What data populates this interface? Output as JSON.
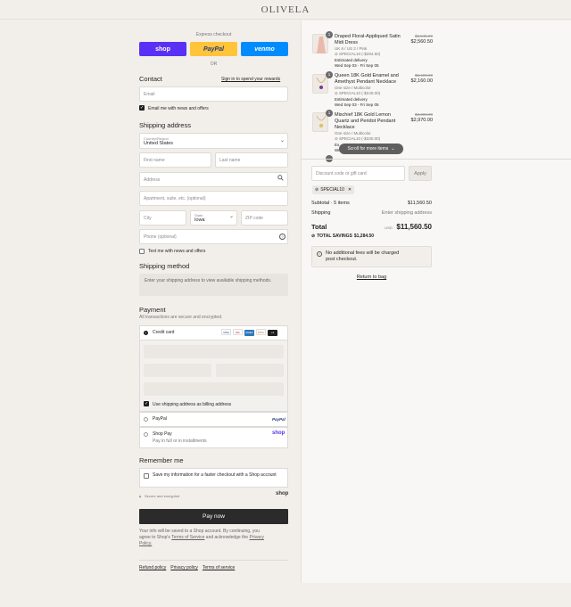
{
  "brand": {
    "logo": "OLIVELA"
  },
  "express": {
    "title": "Express checkout",
    "shop": "shop",
    "paypal": "PayPal",
    "venmo": "venmo",
    "or": "OR"
  },
  "contact": {
    "heading": "Contact",
    "signin_link": "Sign in to spend your rewards",
    "email_placeholder": "Email",
    "email_news": "Email me with news and offers"
  },
  "shipping_address": {
    "heading": "Shipping address",
    "country_label": "Country/Region",
    "country_value": "United States",
    "first_name": "First name",
    "last_name": "Last name",
    "address": "Address",
    "apartment": "Apartment, suite, etc. (optional)",
    "city": "City",
    "state_label": "State",
    "state_value": "Iowa",
    "zip": "ZIP code",
    "phone": "Phone (optional)",
    "text_news": "Text me with news and offers"
  },
  "shipping_method": {
    "heading": "Shipping method",
    "note": "Enter your shipping address to view available shipping methods."
  },
  "payment": {
    "heading": "Payment",
    "subtitle": "All transactions are secure and encrypted.",
    "credit_card": "Credit card",
    "cards": [
      "VISA",
      "MC",
      "AMEX",
      "DISC",
      "+4"
    ],
    "use_shipping_as_billing": "Use shipping address as billing address",
    "paypal": "PayPal",
    "paypal_logo": "PayPal",
    "shop_pay": "Shop Pay",
    "shop_pay_sub": "Pay in full or in installments",
    "shop_pay_logo": "shop"
  },
  "remember": {
    "heading": "Remember me",
    "save_info": "Save my information for a faster checkout with a Shop account",
    "secure": "Secure and encrypted",
    "shop_logo": "shop"
  },
  "pay_now": "Pay now",
  "legal": {
    "line1": "Your info will be saved to a Shop account. By continuing, you",
    "line2a": "agree to Shop's ",
    "tos": "Terms of Service",
    "line2b": " and acknowledge the ",
    "privacy": "Privacy",
    "line3": "Policy."
  },
  "footer_links": [
    "Refund policy",
    "Privacy policy",
    "Terms of service"
  ],
  "items": [
    {
      "qty": "1",
      "name_lines": [
        "Draped Floral-Appliqued Satin",
        "Midi Dress"
      ],
      "variant": "UK 6 / US 2 / Pink",
      "discount": "SPECIAL10 (-$284.50)",
      "delivery_label": "Estimated delivery",
      "delivery": "Wed Sep 03 - Fri Sep 05",
      "orig_price": "$2,845.00",
      "price": "$2,560.50"
    },
    {
      "qty": "1",
      "name_lines": [
        "Queen 18K Gold Enamel and",
        "Amethyst Pendant Necklace"
      ],
      "variant": "One size / Multicolor",
      "discount": "SPECIAL10 (-$240.00)",
      "delivery_label": "Estimated delivery",
      "delivery": "Wed Sep 03 - Fri Sep 05",
      "orig_price": "$2,400.00",
      "price": "$2,160.00"
    },
    {
      "qty": "1",
      "name_lines": [
        "Mischief 18K Gold Lemon",
        "Quartz and Peridot Pendant",
        "Necklace"
      ],
      "variant": "One size / Multicolor",
      "discount": "SPECIAL10 (-$330.00)",
      "delivery_label": "Es",
      "delivery": "We",
      "orig_price": "$3,300.00",
      "price": "$2,970.00"
    }
  ],
  "scroll_hint": "Scroll for more items",
  "discount": {
    "placeholder": "Discount code or gift card",
    "apply": "Apply",
    "applied_code": "SPECIAL10"
  },
  "summary": {
    "subtotal_label": "Subtotal · 5 items",
    "subtotal_value": "$11,560.50",
    "shipping_label": "Shipping",
    "shipping_value": "Enter shipping address",
    "total_label": "Total",
    "currency": "USD",
    "total_value": "$11,560.50",
    "savings_label": "TOTAL SAVINGS",
    "savings_value": "$1,284.50"
  },
  "notice": {
    "line1": "No additional fees will be charged",
    "line2": "post checkout."
  },
  "return_link": "Return to bag",
  "colors": {
    "shop": "#5a31f4",
    "paypal": "#ffc439",
    "venmo": "#008cff",
    "pay_now": "#2b2b2b"
  }
}
